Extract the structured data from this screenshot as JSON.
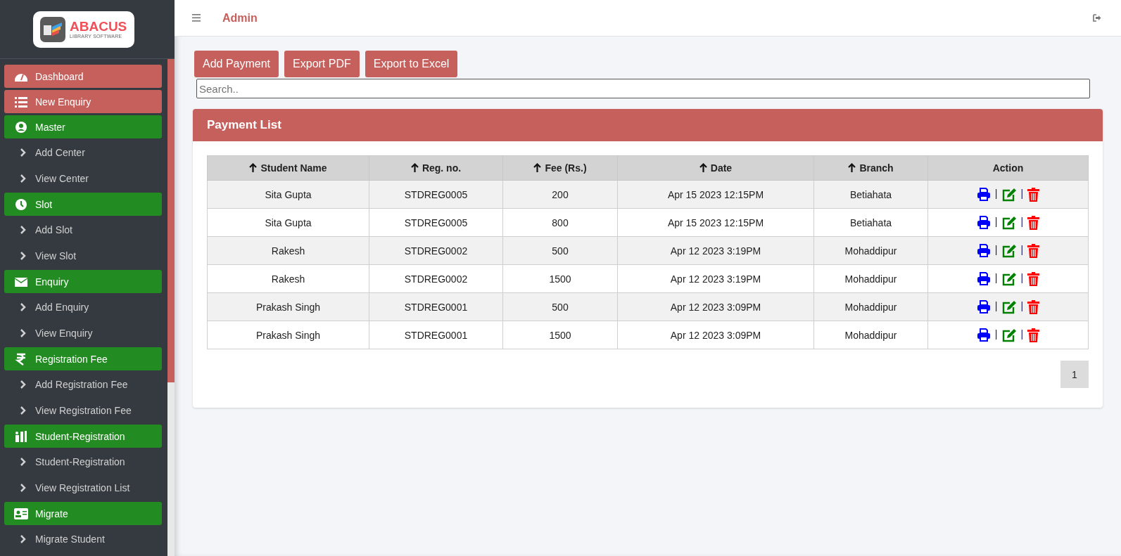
{
  "logo": {
    "name": "ABACUS",
    "tagline": "LIBRARY SOFTWARE"
  },
  "sidebar": {
    "items": [
      {
        "kind": "header",
        "label": "Dashboard",
        "color": "#c5605c"
      },
      {
        "kind": "header",
        "label": "New Enquiry",
        "color": "#c5605c"
      },
      {
        "kind": "header",
        "label": "Master",
        "color": "#228b22"
      },
      {
        "kind": "link",
        "label": "Add Center"
      },
      {
        "kind": "link",
        "label": "View Center"
      },
      {
        "kind": "header",
        "label": "Slot",
        "color": "#228b22"
      },
      {
        "kind": "link",
        "label": "Add Slot"
      },
      {
        "kind": "link",
        "label": "View Slot"
      },
      {
        "kind": "header",
        "label": "Enquiry",
        "color": "#228b22"
      },
      {
        "kind": "link",
        "label": "Add Enquiry"
      },
      {
        "kind": "link",
        "label": "View Enquiry"
      },
      {
        "kind": "header",
        "label": "Registration Fee",
        "color": "#228b22"
      },
      {
        "kind": "link",
        "label": "Add Registration Fee"
      },
      {
        "kind": "link",
        "label": "View Registration Fee"
      },
      {
        "kind": "header",
        "label": "Student-Registration",
        "color": "#228b22"
      },
      {
        "kind": "link",
        "label": "Student-Registration"
      },
      {
        "kind": "link",
        "label": "View Registration List"
      },
      {
        "kind": "header",
        "label": "Migrate",
        "color": "#228b22"
      },
      {
        "kind": "link",
        "label": "Migrate Student"
      }
    ]
  },
  "header": {
    "title": "Admin"
  },
  "buttons": [
    "Add Payment",
    "Export PDF",
    "Export to Excel"
  ],
  "search": {
    "placeholder": "Search.."
  },
  "card": {
    "title": "Payment List"
  },
  "table": {
    "columns": [
      {
        "label": "Student Name",
        "sortable": true
      },
      {
        "label": "Reg. no.",
        "sortable": true
      },
      {
        "label": "Fee (Rs.)",
        "sortable": true
      },
      {
        "label": "Date",
        "sortable": true
      },
      {
        "label": "Branch",
        "sortable": true
      },
      {
        "label": "Action",
        "sortable": false
      }
    ],
    "rows": [
      {
        "cells": [
          "Sita Gupta",
          "STDREG0005",
          "200",
          "Apr 15 2023 12:15PM",
          "Betiahata"
        ],
        "separators": [
          "|",
          "|"
        ]
      },
      {
        "cells": [
          "Sita Gupta",
          "STDREG0005",
          "800",
          "Apr 15 2023 12:15PM",
          "Betiahata"
        ],
        "separators": [
          "|",
          "|"
        ]
      },
      {
        "cells": [
          "Rakesh",
          "STDREG0002",
          "500",
          "Apr 12 2023 3:19PM",
          "Mohaddipur"
        ],
        "separators": [
          "|",
          "|"
        ]
      },
      {
        "cells": [
          "Rakesh",
          "STDREG0002",
          "1500",
          "Apr 12 2023 3:19PM",
          "Mohaddipur"
        ],
        "separators": [
          "|",
          "|"
        ]
      },
      {
        "cells": [
          "Prakash Singh",
          "STDREG0001",
          "500",
          "Apr 12 2023 3:09PM",
          "Mohaddipur"
        ],
        "separators": [
          "|",
          "|"
        ]
      },
      {
        "cells": [
          "Prakash Singh",
          "STDREG0001",
          "1500",
          "Apr 12 2023 3:09PM",
          "Mohaddipur"
        ],
        "separators": [
          "|",
          "|"
        ]
      }
    ]
  },
  "pagination": [
    {
      "label": "1",
      "selected": true
    }
  ]
}
